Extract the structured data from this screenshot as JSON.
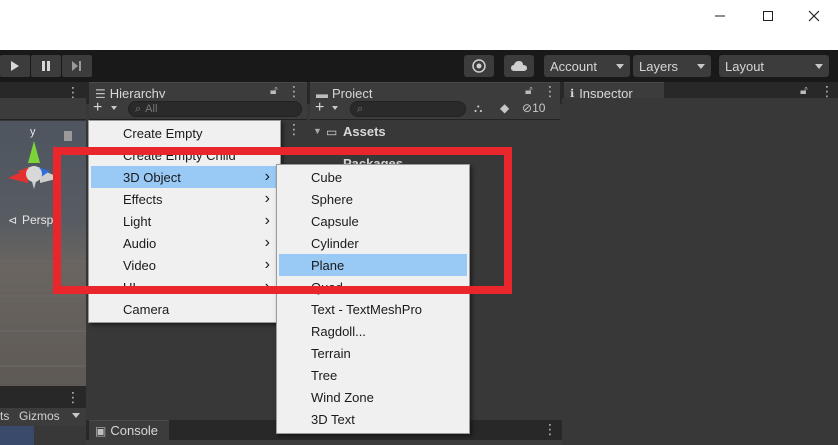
{
  "window": {
    "minimize_icon": "minimize-icon",
    "maximize_icon": "maximize-icon",
    "close_icon": "close-icon"
  },
  "toolbar": {
    "account_label": "Account",
    "layers_label": "Layers",
    "layout_label": "Layout"
  },
  "hierarchy": {
    "tab_label": "Hierarchy",
    "search_placeholder": "All"
  },
  "project": {
    "tab_label": "Project",
    "hidden_count": "10",
    "assets_label": "Assets",
    "packages_label": "Packages"
  },
  "inspector": {
    "tab_label": "Inspector"
  },
  "scene": {
    "axis_label": "y",
    "persp_label": "Persp"
  },
  "bottom": {
    "gizmos_label": "Gizmos",
    "console_label": "Console",
    "left_cut_label": "ts"
  },
  "create_menu": {
    "items": [
      {
        "label": "Create Empty",
        "submenu": false
      },
      {
        "label": "Create Empty Child",
        "submenu": false
      },
      {
        "label": "3D Object",
        "submenu": true
      },
      {
        "label": "Effects",
        "submenu": true
      },
      {
        "label": "Light",
        "submenu": true
      },
      {
        "label": "Audio",
        "submenu": true
      },
      {
        "label": "Video",
        "submenu": true
      },
      {
        "label": "UI",
        "submenu": true
      },
      {
        "label": "Camera",
        "submenu": false
      }
    ],
    "highlighted": "3D Object"
  },
  "object_submenu": {
    "items": [
      "Cube",
      "Sphere",
      "Capsule",
      "Cylinder",
      "Plane",
      "Quad",
      "Text - TextMeshPro",
      "Ragdoll...",
      "Terrain",
      "Tree",
      "Wind Zone",
      "3D Text"
    ],
    "highlighted": "Plane"
  },
  "colors": {
    "highlight": "#99c9f5",
    "annotation": "#e8262b",
    "menu_bg": "#f0f0f0"
  }
}
